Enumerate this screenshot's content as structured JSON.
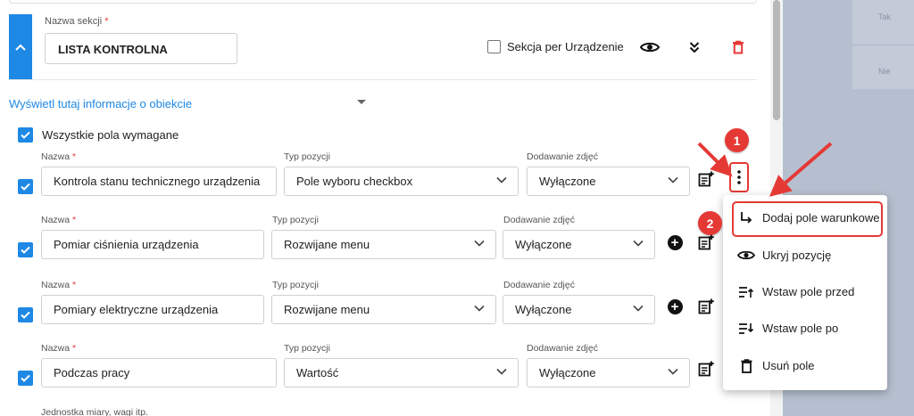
{
  "section": {
    "name_label": "Nazwa sekcji",
    "required_mark": "*",
    "name_value": "LISTA KONTROLNA",
    "per_device_label": "Sekcja per Urządzenie"
  },
  "info_link": "Wyświetl tutaj informacje o obiekcie",
  "all_required_label": "Wszystkie pola wymagane",
  "labels": {
    "name": "Nazwa",
    "type": "Typ pozycji",
    "photos": "Dodawanie zdjęć"
  },
  "rows": [
    {
      "name": "Kontrola stanu technicznego urządzenia",
      "type": "Pole wyboru checkbox",
      "photos": "Wyłączone"
    },
    {
      "name": "Pomiar ciśnienia urządzenia",
      "type": "Rozwijane menu",
      "photos": "Wyłączone"
    },
    {
      "name": "Pomiary elektryczne urządzenia",
      "type": "Rozwijane menu",
      "photos": "Wyłączone"
    },
    {
      "name": "Podczas pracy",
      "type": "Wartość",
      "photos": "Wyłączone"
    }
  ],
  "units_label": "Jednostka miary, wagi itp.",
  "context_menu": {
    "items": [
      {
        "label": "Dodaj pole warunkowe",
        "icon": "subdirectory-arrow-icon"
      },
      {
        "label": "Ukryj pozycję",
        "icon": "eye-icon"
      },
      {
        "label": "Wstaw pole przed",
        "icon": "insert-before-icon"
      },
      {
        "label": "Wstaw pole po",
        "icon": "insert-after-icon"
      },
      {
        "label": "Usuń pole",
        "icon": "trash-icon"
      }
    ]
  },
  "annotations": {
    "badge_1": "1",
    "badge_2": "2"
  },
  "background_texts": [
    "Tak",
    "Nie"
  ],
  "colors": {
    "accent": "#1e88e5",
    "annotation_red": "#e53935",
    "overlay": "#b6bfcf"
  }
}
